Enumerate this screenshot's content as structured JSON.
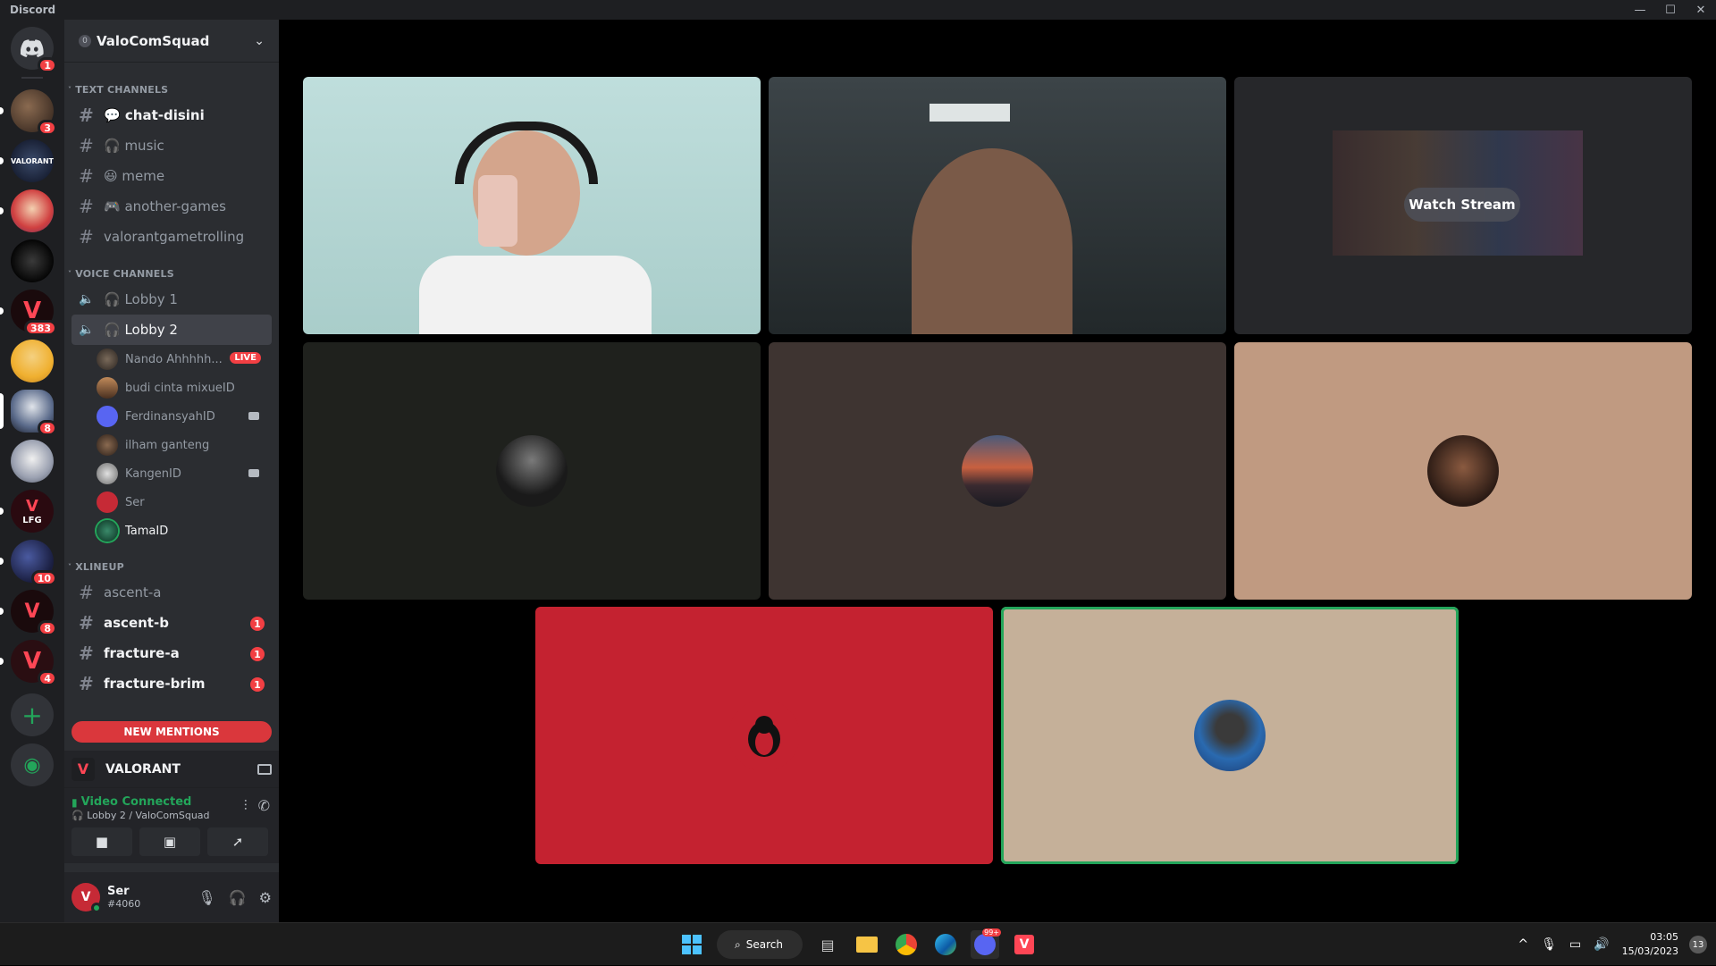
{
  "window": {
    "title": "Discord",
    "controls": [
      "minimize",
      "maximize",
      "close"
    ]
  },
  "server_rail": {
    "home_badge": "1",
    "servers": [
      {
        "name": "server-1",
        "badge": "3",
        "unread": true
      },
      {
        "name": "valorant-server",
        "badge": "",
        "unread": true
      },
      {
        "name": "server-anime",
        "badge": "",
        "unread": true
      },
      {
        "name": "server-dark",
        "badge": "",
        "unread": false
      },
      {
        "name": "valorant-red",
        "badge": "383",
        "unread": true
      },
      {
        "name": "server-face",
        "badge": "",
        "unread": false
      },
      {
        "name": "ValoComSquad",
        "badge": "8",
        "unread": false,
        "selected": true
      },
      {
        "name": "server-cat",
        "badge": "",
        "unread": false
      },
      {
        "name": "LFG",
        "badge": "",
        "unread": true
      },
      {
        "name": "server-night",
        "badge": "10",
        "unread": true
      },
      {
        "name": "server-rocket",
        "badge": "8",
        "unread": true
      },
      {
        "name": "valorant-4",
        "badge": "4",
        "unread": true
      }
    ],
    "add_server": "+",
    "explore": "explore"
  },
  "guild": {
    "name": "ValoComSquad",
    "boost": "0"
  },
  "text_category": "TEXT CHANNELS",
  "text_channels": [
    {
      "name": "💬 chat-disini",
      "unread": true
    },
    {
      "name": "🎧 music",
      "unread": false
    },
    {
      "name": "😃 meme",
      "unread": false
    },
    {
      "name": "🎮 another-games",
      "unread": false
    },
    {
      "name": "valorantgametrolling",
      "unread": false
    }
  ],
  "voice_category": "VOICE CHANNELS",
  "voice_channels": [
    {
      "name": "🎧 Lobby 1"
    },
    {
      "name": "🎧 Lobby 2",
      "selected": true
    }
  ],
  "voice_users": [
    {
      "name": "Nando Ahhhhh...",
      "live": "LIVE",
      "color": "#5c4a3a"
    },
    {
      "name": "budi cinta mixueID",
      "color": "#7a5a40"
    },
    {
      "name": "FerdinansyahID",
      "cam": true,
      "color": "#5865f2"
    },
    {
      "name": "ilham ganteng",
      "color": "#4a3a30"
    },
    {
      "name": "KangenID",
      "cam": true,
      "color": "#9a9a9a"
    },
    {
      "name": "Ser",
      "color": "#c62a36"
    },
    {
      "name": "TamaID",
      "color": "#1e6e4a",
      "active": true
    }
  ],
  "lineup_category": "XLINEUP",
  "lineup_channels": [
    {
      "name": "ascent-a",
      "unread": false,
      "mention": ""
    },
    {
      "name": "ascent-b",
      "unread": true,
      "mention": "1"
    },
    {
      "name": "fracture-a",
      "unread": true,
      "mention": "1"
    },
    {
      "name": "fracture-brim",
      "unread": true,
      "mention": "1"
    }
  ],
  "new_mentions": "NEW MENTIONS",
  "activity": {
    "game": "VALORANT"
  },
  "voice_panel": {
    "status": "Video Connected",
    "location": "🎧 Lobby 2 / ValoComSquad"
  },
  "user": {
    "name": "Ser",
    "tag": "#4060"
  },
  "stage": {
    "watch_stream": "Watch Stream",
    "tile_colors": [
      "#1f211d",
      "#3e3431",
      "#c09a81",
      "#c42230",
      "#c5b099"
    ]
  },
  "taskbar": {
    "search": "Search",
    "time": "03:05",
    "date": "15/03/2023",
    "notifications": "13",
    "discord_badge": "99+"
  }
}
